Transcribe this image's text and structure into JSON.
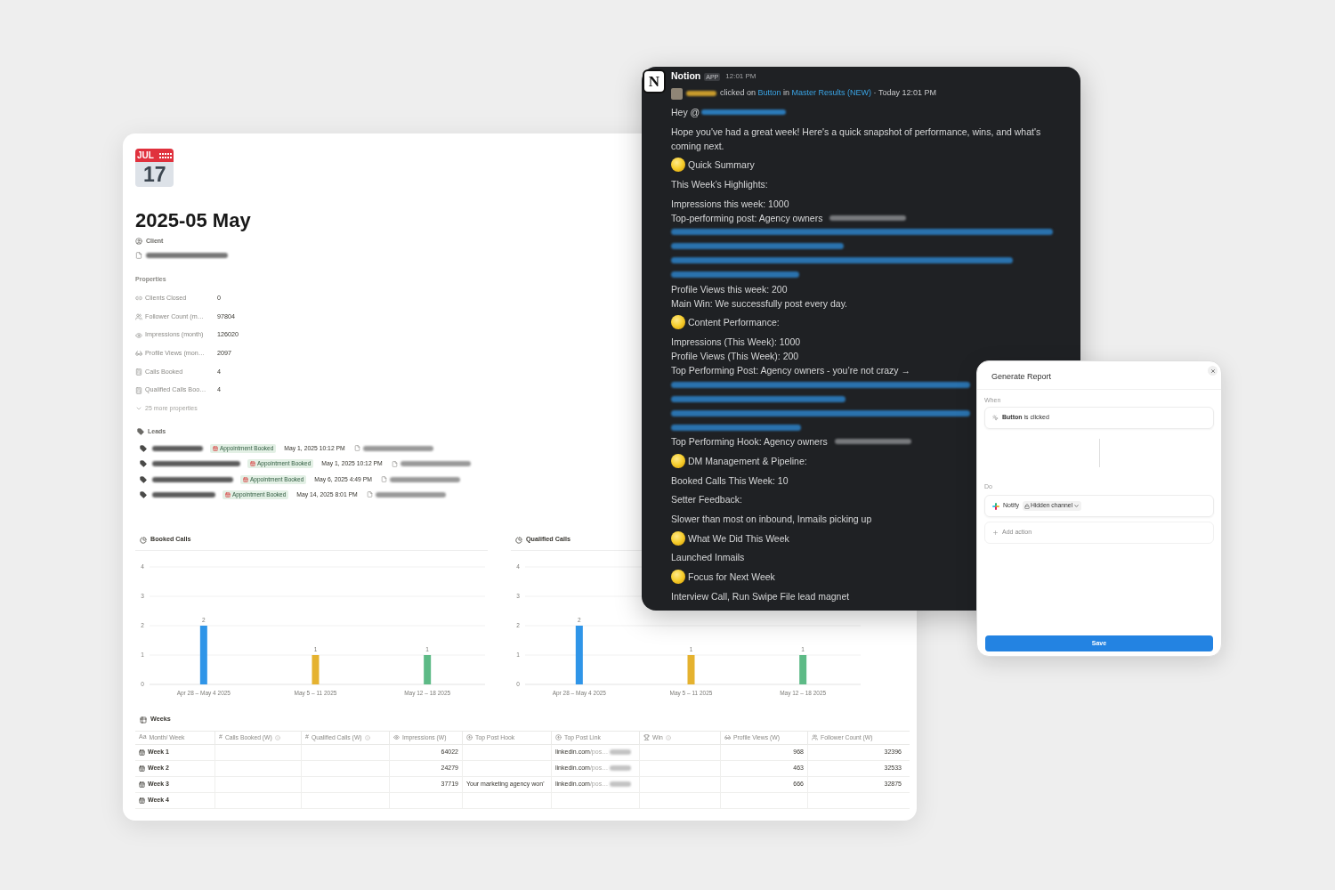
{
  "page": {
    "icon": {
      "month": "JUL",
      "day": "17"
    },
    "title": "2025-05 May",
    "client_label": "Client",
    "properties_label": "Properties",
    "properties": [
      {
        "kind": "relation",
        "label": "Clients Closed",
        "value": "0"
      },
      {
        "kind": "people",
        "label": "Follower Count (m…",
        "value": "97804"
      },
      {
        "kind": "eye",
        "label": "Impressions (month)",
        "value": "126020"
      },
      {
        "kind": "glasses",
        "label": "Profile Views (mon…",
        "value": "2097"
      },
      {
        "kind": "formula",
        "label": "Calls Booked",
        "value": "4"
      },
      {
        "kind": "formula",
        "label": "Qualified Calls Boo…",
        "value": "4"
      }
    ],
    "more_properties": "25 more properties",
    "leads": {
      "label": "Leads",
      "rows": [
        {
          "status": "Appointment Booked",
          "date": "May 1, 2025 10:12 PM"
        },
        {
          "status": "Appointment Booked",
          "date": "May 1, 2025 10:12 PM"
        },
        {
          "status": "Appointment Booked",
          "date": "May 6, 2025 4:49 PM"
        },
        {
          "status": "Appointment Booked",
          "date": "May 14, 2025 8:01 PM"
        }
      ]
    },
    "charts": [
      {
        "chart_data": {
          "type": "bar",
          "title": "Booked Calls",
          "categories": [
            "Apr 28 – May 4 2025",
            "May 5 – 11 2025",
            "May 12 – 18 2025"
          ],
          "values": [
            2,
            1,
            1
          ],
          "colors": [
            "#2f95e8",
            "#e5b22f",
            "#5dba86"
          ],
          "ylim": [
            0,
            4
          ],
          "yticks": [
            0,
            1,
            2,
            3,
            4
          ],
          "grid": true,
          "data_labels": true
        }
      },
      {
        "chart_data": {
          "type": "bar",
          "title": "Qualified Calls",
          "categories": [
            "Apr 28 – May 4 2025",
            "May 5 – 11 2025",
            "May 12 – 18 2025"
          ],
          "values": [
            2,
            1,
            1
          ],
          "colors": [
            "#2f95e8",
            "#e5b22f",
            "#5dba86"
          ],
          "ylim": [
            0,
            4
          ],
          "yticks": [
            0,
            1,
            2,
            3,
            4
          ],
          "grid": true,
          "data_labels": true
        }
      }
    ],
    "table": {
      "title": "Weeks",
      "columns": [
        {
          "kind": "title",
          "glyph": "Aa",
          "label": "Month/ Week",
          "info": false
        },
        {
          "kind": "number",
          "glyph": "#",
          "label": "Calls Booked (W)",
          "info": true
        },
        {
          "kind": "number",
          "glyph": "#",
          "label": "Qualified Calls (W)",
          "info": true
        },
        {
          "kind": "eye",
          "label": "Impressions (W)",
          "info": false
        },
        {
          "kind": "rollup",
          "label": "Top Post Hook",
          "info": false
        },
        {
          "kind": "rollup",
          "label": "Top Post Link",
          "info": false
        },
        {
          "kind": "trophy",
          "label": "Win",
          "info": true
        },
        {
          "kind": "glasses",
          "label": "Profile Views (W)",
          "info": false
        },
        {
          "kind": "people",
          "label": "Follower Count (W)",
          "info": false
        }
      ],
      "rows": [
        {
          "week": "Week 1",
          "impressions": "64022",
          "top_post_link": {
            "domain": "linkedin.com",
            "path": "/pos…",
            "redacted": true
          },
          "profile_views": "968",
          "follower_count": "32396"
        },
        {
          "week": "Week 2",
          "impressions": "24279",
          "top_post_link": {
            "domain": "linkedin.com",
            "path": "/pos…",
            "redacted": true
          },
          "profile_views": "463",
          "follower_count": "32533"
        },
        {
          "week": "Week 3",
          "impressions": "37719",
          "top_post_hook": "Your marketing agency won'",
          "top_post_link": {
            "domain": "linkedin.com",
            "path": "/pos…",
            "redacted": true
          },
          "profile_views": "666",
          "follower_count": "32875"
        },
        {
          "week": "Week 4"
        }
      ]
    }
  },
  "message": {
    "logo_letter": "N",
    "sender": "Notion",
    "badge": "APP",
    "time": "12:01 PM",
    "activity": {
      "action": "clicked on",
      "button": "Button",
      "preposition": "in",
      "page": "Master Results (NEW)",
      "when": "· Today 12:01 PM"
    },
    "blocks": [
      {
        "kind": "mention",
        "text": "Hey @"
      },
      {
        "kind": "text",
        "text": "Hope you've had a great week! Here's a quick snapshot of performance, wins, and what's coming next."
      },
      {
        "kind": "heading",
        "text": "Quick Summary"
      },
      {
        "kind": "text",
        "text": "This Week’s Highlights:"
      },
      {
        "kind": "lines",
        "lines": [
          {
            "kind": "text",
            "text": "Impressions this week: 1000",
            "redacted": false
          },
          {
            "kind": "text",
            "text": "Top-performing post: Agency owners",
            "redacted": true
          },
          {
            "kind": "redacted_link"
          },
          {
            "kind": "text",
            "text": "Profile Views this week: 200",
            "redacted": false
          },
          {
            "kind": "text",
            "text": "Main Win: We successfully post every day.",
            "redacted": false
          }
        ]
      },
      {
        "kind": "heading",
        "text": "Content Performance:"
      },
      {
        "kind": "lines",
        "lines": [
          {
            "kind": "text",
            "text": "Impressions (This Week): 1000",
            "redacted": false
          },
          {
            "kind": "text",
            "text": "Profile Views (This Week): 200",
            "redacted": false
          },
          {
            "kind": "text",
            "text": "Top Performing Post: Agency owners - you’re not crazy →",
            "redacted": false
          },
          {
            "kind": "redacted_link"
          },
          {
            "kind": "text",
            "text": "Top Performing Hook: Agency owners",
            "redacted": true
          }
        ]
      },
      {
        "kind": "heading",
        "text": "DM Management & Pipeline:"
      },
      {
        "kind": "text",
        "text": "Booked Calls This Week: 10"
      },
      {
        "kind": "text",
        "text": "Setter Feedback:"
      },
      {
        "kind": "text",
        "text": "Slower than most on inbound, Inmails picking up"
      },
      {
        "kind": "heading",
        "text": "What We Did This Week"
      },
      {
        "kind": "text",
        "text": "Launched Inmails"
      },
      {
        "kind": "heading",
        "text": "Focus for Next Week"
      },
      {
        "kind": "text",
        "text": "Interview Call, Run Swipe File lead magnet"
      }
    ]
  },
  "dialog": {
    "title": "Generate Report",
    "when_label": "When",
    "trigger": "**Button** is clicked",
    "do_label": "Do",
    "action": {
      "verb": "Notify",
      "channel": "Hidden channel"
    },
    "add_action": "Add action",
    "save": "Save"
  }
}
